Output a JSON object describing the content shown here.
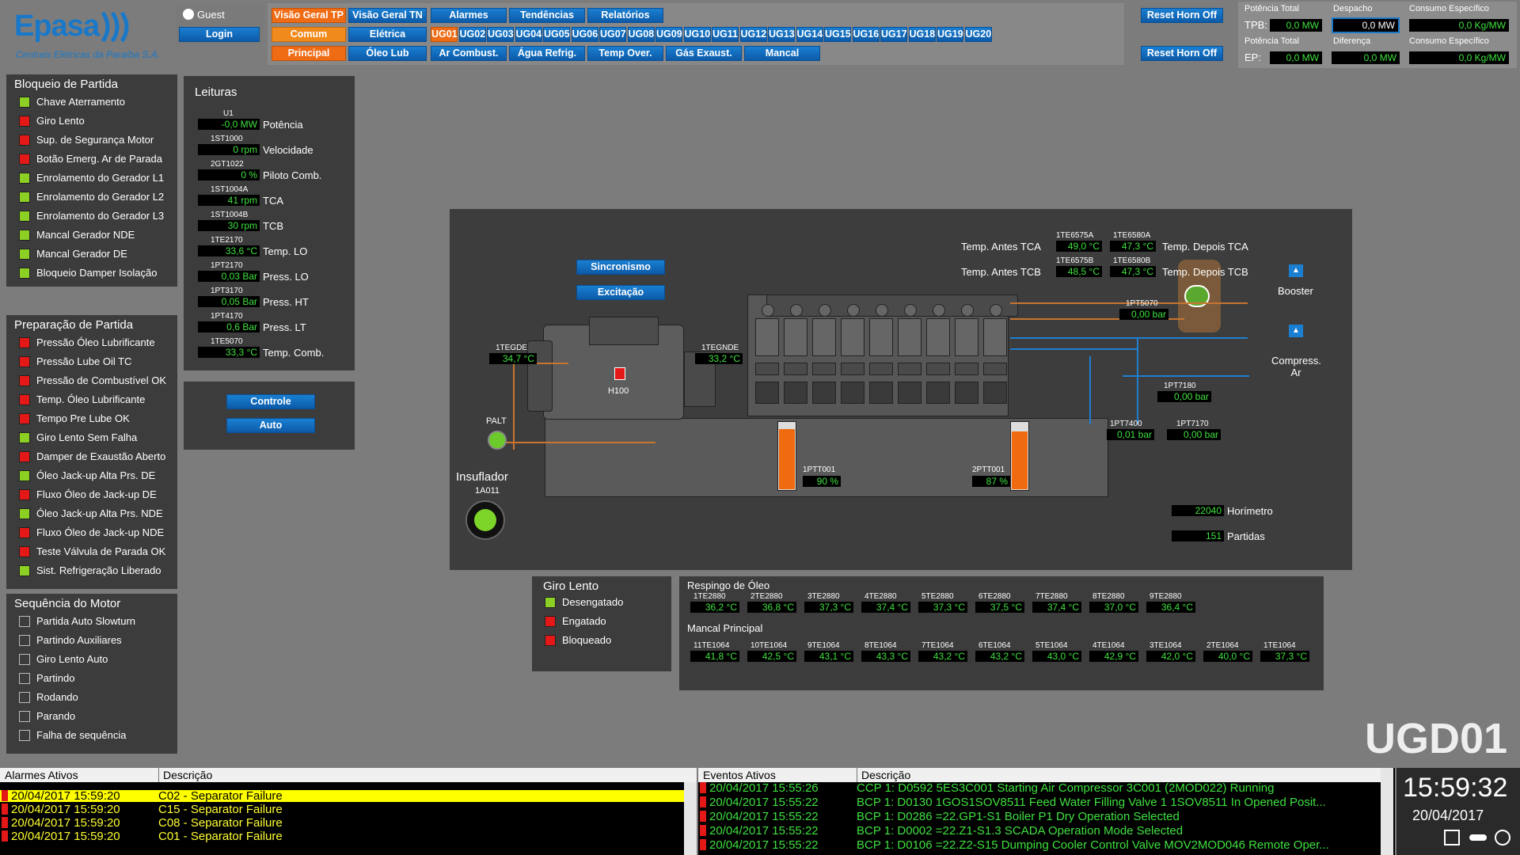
{
  "company": {
    "name": "Epasa",
    "subtitle": "Centrais Elétricas da Paraíba S.A."
  },
  "user": {
    "name": "Guest",
    "login_label": "Login"
  },
  "nav_row1": [
    "Visão Geral TP",
    "Visão Geral TN",
    "Alarmes",
    "Tendências",
    "Relatórios"
  ],
  "nav_row2": [
    "Comum",
    "Elétrica"
  ],
  "nav_row3": [
    "Principal",
    "Óleo Lub",
    "Ar Combust.",
    "Água Refrig.",
    "Temp Over.",
    "Gás Exaust.",
    "Mancal"
  ],
  "ug_tabs": [
    "UG01",
    "UG02",
    "UG03",
    "UG04",
    "UG05",
    "UG06",
    "UG07",
    "UG08",
    "UG09",
    "UG10",
    "UG11",
    "UG12",
    "UG13",
    "UG14",
    "UG15",
    "UG16",
    "UG17",
    "UG18",
    "UG19",
    "UG20"
  ],
  "reset_horn": [
    "Reset Horn Off",
    "Reset Horn Off"
  ],
  "summary": {
    "pot_total_label": "Potência Total",
    "despacho_label": "Despacho",
    "consumo_label": "Consumo Específico",
    "tpb_label": "TPB:",
    "tpb_value": "0,0 MW",
    "despacho_value": "0,0 MW",
    "consumo_value": "0,0 Kg/MW",
    "pot_total2_label": "Potência Total",
    "diferenca_label": "Diferença",
    "consumo2_label": "Consumo Específico",
    "ep_label": "EP:",
    "ep_value": "0,0 MW",
    "diferenca_value": "0,0 MW",
    "consumo2_value": "0,0 Kg/MW"
  },
  "bloqueio": {
    "title": "Bloqueio de Partida",
    "items": [
      {
        "label": "Chave Aterramento",
        "state": "g"
      },
      {
        "label": "Giro Lento",
        "state": "r"
      },
      {
        "label": "Sup. de Segurança Motor",
        "state": "r"
      },
      {
        "label": "Botão Emerg. Ar de Parada",
        "state": "r"
      },
      {
        "label": "Enrolamento do Gerador L1",
        "state": "g"
      },
      {
        "label": "Enrolamento do Gerador L2",
        "state": "g"
      },
      {
        "label": "Enrolamento do Gerador L3",
        "state": "g"
      },
      {
        "label": "Mancal Gerador NDE",
        "state": "g"
      },
      {
        "label": "Mancal Gerador DE",
        "state": "g"
      },
      {
        "label": "Bloqueio Damper Isolação",
        "state": "g"
      }
    ]
  },
  "preparacao": {
    "title": "Preparação de Partida",
    "items": [
      {
        "label": "Pressão Óleo Lubrificante",
        "state": "r"
      },
      {
        "label": "Pressão Lube Oil TC",
        "state": "r"
      },
      {
        "label": "Pressão de Combustível OK",
        "state": "r"
      },
      {
        "label": "Temp. Óleo Lubrificante",
        "state": "r"
      },
      {
        "label": "Tempo Pre Lube OK",
        "state": "r"
      },
      {
        "label": "Giro Lento Sem Falha",
        "state": "g"
      },
      {
        "label": "Damper de Exaustão Aberto",
        "state": "r"
      },
      {
        "label": "Óleo Jack-up Alta Prs. DE",
        "state": "g"
      },
      {
        "label": "Fluxo Óleo de Jack-up DE",
        "state": "r"
      },
      {
        "label": "Óleo Jack-up Alta Prs. NDE",
        "state": "g"
      },
      {
        "label": "Fluxo Óleo de Jack-up NDE",
        "state": "r"
      },
      {
        "label": "Teste Válvula de Parada OK",
        "state": "r"
      },
      {
        "label": "Sist. Refrigeração Liberado",
        "state": "g"
      }
    ]
  },
  "sequencia": {
    "title": "Sequência do Motor",
    "items": [
      {
        "label": "Partida Auto Slowturn",
        "state": "n"
      },
      {
        "label": "Partindo Auxiliares",
        "state": "n"
      },
      {
        "label": "Giro Lento Auto",
        "state": "n"
      },
      {
        "label": "Partindo",
        "state": "n"
      },
      {
        "label": "Rodando",
        "state": "n"
      },
      {
        "label": "Parando",
        "state": "n"
      },
      {
        "label": "Falha de sequência",
        "state": "n"
      }
    ]
  },
  "leituras": {
    "title": "Leituras",
    "items": [
      {
        "tag": "U1",
        "value": "-0,0 MW",
        "label": "Potência"
      },
      {
        "tag": "1ST1000",
        "value": "0 rpm",
        "label": "Velocidade"
      },
      {
        "tag": "2GT1022",
        "value": "0  %",
        "label": "Piloto Comb."
      },
      {
        "tag": "1ST1004A",
        "value": "41 rpm",
        "label": "TCA"
      },
      {
        "tag": "1ST1004B",
        "value": "30 rpm",
        "label": "TCB"
      },
      {
        "tag": "1TE2170",
        "value": "33,6 °C",
        "label": "Temp. LO"
      },
      {
        "tag": "1PT2170",
        "value": "0,03 Bar",
        "label": "Press. LO"
      },
      {
        "tag": "1PT3170",
        "value": "0,05 Bar",
        "label": "Press. HT"
      },
      {
        "tag": "1PT4170",
        "value": "0,6 Bar",
        "label": "Press. LT"
      },
      {
        "tag": "1TE5070",
        "value": "33,3  °C",
        "label": "Temp. Comb."
      }
    ]
  },
  "modes": {
    "controle": "Controle",
    "auto": "Auto"
  },
  "engine": {
    "sincronismo": "Sincronismo",
    "excitacao": "Excitação",
    "temp_antes_tca": "Temp. Antes TCA",
    "temp_antes_tcb": "Temp. Antes TCB",
    "temp_depois_tca": "Temp. Depois TCA",
    "temp_depois_tcb": "Temp. Depois TCB",
    "te6575a_tag": "1TE6575A",
    "te6575a": "49,0 °C",
    "te6580a_tag": "1TE6580A",
    "te6580a": "47,3 °C",
    "te6575b_tag": "1TE6575B",
    "te6575b": "48,5 °C",
    "te6580b_tag": "1TE6580B",
    "te6580b": "47,3 °C",
    "tegde_tag": "1TEGDE",
    "tegde": "34,7 °C",
    "tegnde_tag": "1TEGNDE",
    "tegnde": "33,2 °C",
    "h100": "H100",
    "palt": "PALT",
    "pt5070_tag": "1PT5070",
    "pt5070": "0,00 bar",
    "pt7180_tag": "1PT7180",
    "pt7180": "0,00 bar",
    "pt7400_tag": "1PT7400",
    "pt7400": "0,01 bar",
    "pt7170_tag": "1PT7170",
    "pt7170": "0,00 bar",
    "booster": "Booster",
    "compress": "Compress. Ar",
    "ptt001_1_tag": "1PTT001",
    "ptt001_1": "90  %",
    "ptt001_2_tag": "2PTT001",
    "ptt001_2": "87  %",
    "ptt001_1_level": 0.9,
    "ptt001_2_level": 0.87,
    "insuflador": "Insuflador",
    "insuflador_tag": "1A011",
    "horimetro_value": "22040",
    "horimetro": "Horímetro",
    "partidas_value": "151",
    "partidas": "Partidas"
  },
  "giro_lento": {
    "title": "Giro Lento",
    "items": [
      {
        "label": "Desengatado",
        "state": "g"
      },
      {
        "label": "Engatado",
        "state": "r"
      },
      {
        "label": "Bloqueado",
        "state": "r"
      }
    ]
  },
  "respingo": {
    "title": "Respingo de Óleo",
    "items": [
      {
        "tag": "1TE2880",
        "value": "36,2 °C"
      },
      {
        "tag": "2TE2880",
        "value": "36,8 °C"
      },
      {
        "tag": "3TE2880",
        "value": "37,3 °C"
      },
      {
        "tag": "4TE2880",
        "value": "37,4 °C"
      },
      {
        "tag": "5TE2880",
        "value": "37,3 °C"
      },
      {
        "tag": "6TE2880",
        "value": "37,5 °C"
      },
      {
        "tag": "7TE2880",
        "value": "37,4 °C"
      },
      {
        "tag": "8TE2880",
        "value": "37,0 °C"
      },
      {
        "tag": "9TE2880",
        "value": "36,4 °C"
      }
    ]
  },
  "mancal": {
    "title": "Mancal Principal",
    "items": [
      {
        "tag": "11TE1064",
        "value": "41,8 °C"
      },
      {
        "tag": "10TE1064",
        "value": "42,5 °C"
      },
      {
        "tag": "9TE1064",
        "value": "43,1 °C"
      },
      {
        "tag": "8TE1064",
        "value": "43,3 °C"
      },
      {
        "tag": "7TE1064",
        "value": "43,2 °C"
      },
      {
        "tag": "6TE1064",
        "value": "43,2 °C"
      },
      {
        "tag": "5TE1064",
        "value": "43,0 °C"
      },
      {
        "tag": "4TE1064",
        "value": "42,9 °C"
      },
      {
        "tag": "3TE1064",
        "value": "42,0 °C"
      },
      {
        "tag": "2TE1064",
        "value": "40,0 °C"
      },
      {
        "tag": "1TE1064",
        "value": "37,3 °C"
      }
    ]
  },
  "unit_label": "UGD01",
  "alarms": {
    "col1": "Alarmes Ativos",
    "col2": "Descrição",
    "rows": [
      {
        "time": "20/04/2017 15:59:20",
        "desc": "C02 - Separator Failure",
        "highlight": true
      },
      {
        "time": "20/04/2017 15:59:20",
        "desc": "C15 - Separator Failure",
        "highlight": false
      },
      {
        "time": "20/04/2017 15:59:20",
        "desc": "C08 - Separator Failure",
        "highlight": false
      },
      {
        "time": "20/04/2017 15:59:20",
        "desc": "C01 - Separator Failure",
        "highlight": false
      }
    ]
  },
  "events": {
    "col1": "Eventos Ativos",
    "col2": "Descrição",
    "rows": [
      {
        "time": "20/04/2017 15:55:26",
        "desc": "CCP 1: D0592 5ES3C001 Starting Air Compressor 3C001 (2MOD022) Running"
      },
      {
        "time": "20/04/2017 15:55:22",
        "desc": "BCP 1: D0130 1GOS1SOV8511 Feed Water Filling Valve 1 1SOV8511 In Opened Posit..."
      },
      {
        "time": "20/04/2017 15:55:22",
        "desc": "BCP 1: D0286 =22.GP1-S1 Boiler P1 Dry Operation Selected"
      },
      {
        "time": "20/04/2017 15:55:22",
        "desc": "BCP 1: D0002 =22.Z1-S1.3 SCADA Operation Mode Selected"
      },
      {
        "time": "20/04/2017 15:55:22",
        "desc": "BCP 1: D0106 =22.Z2-S15 Dumping Cooler Control Valve MOV2MOD046 Remote Oper..."
      }
    ]
  },
  "clock": {
    "time": "15:59:32",
    "date": "20/04/2017"
  }
}
